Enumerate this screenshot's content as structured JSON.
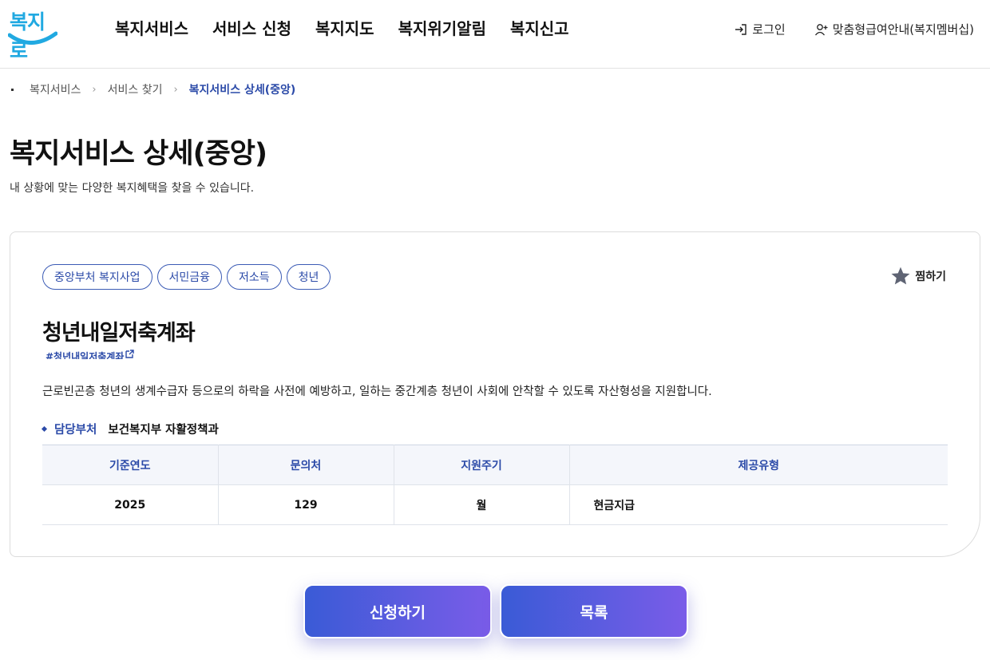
{
  "logo": {
    "text": "복지로"
  },
  "gnb": [
    {
      "label": "복지서비스"
    },
    {
      "label": "서비스 신청"
    },
    {
      "label": "복지지도"
    },
    {
      "label": "복지위기알림"
    },
    {
      "label": "복지신고"
    }
  ],
  "util": {
    "login": "로그인",
    "membership": "맞춤형급여안내(복지멤버십)"
  },
  "breadcrumb": {
    "items": [
      "복지서비스",
      "서비스 찾기"
    ],
    "current": "복지서비스 상세(중앙)"
  },
  "page": {
    "title": "복지서비스 상세(중앙)",
    "desc": "내 상황에 맞는 다양한 복지혜택을 찾을 수 있습니다."
  },
  "card": {
    "tags": [
      "중앙부처 복지사업",
      "서민금융",
      "저소득",
      "청년"
    ],
    "favorite_label": "찜하기",
    "title": "청년내일저축계좌",
    "hashtag": "#청년내일저축계좌",
    "description": "근로빈곤층 청년의 생계수급자 등으로의 하락을 사전에 예방하고, 일하는 중간계층 청년이 사회에 안착할 수 있도록 자산형성을 지원합니다.",
    "dept_label": "담당부처",
    "dept_value": "보건복지부 자활정책과",
    "table": {
      "headers": [
        "기준연도",
        "문의처",
        "지원주기",
        "제공유형"
      ],
      "row": [
        "2025",
        "129",
        "월",
        "현금지급"
      ]
    }
  },
  "buttons": {
    "apply": "신청하기",
    "list": "목록"
  },
  "colors": {
    "accent": "#2b4aa8",
    "logo": "#21a9e1",
    "button_start": "#3a5bd6",
    "button_end": "#7a5ce8"
  }
}
